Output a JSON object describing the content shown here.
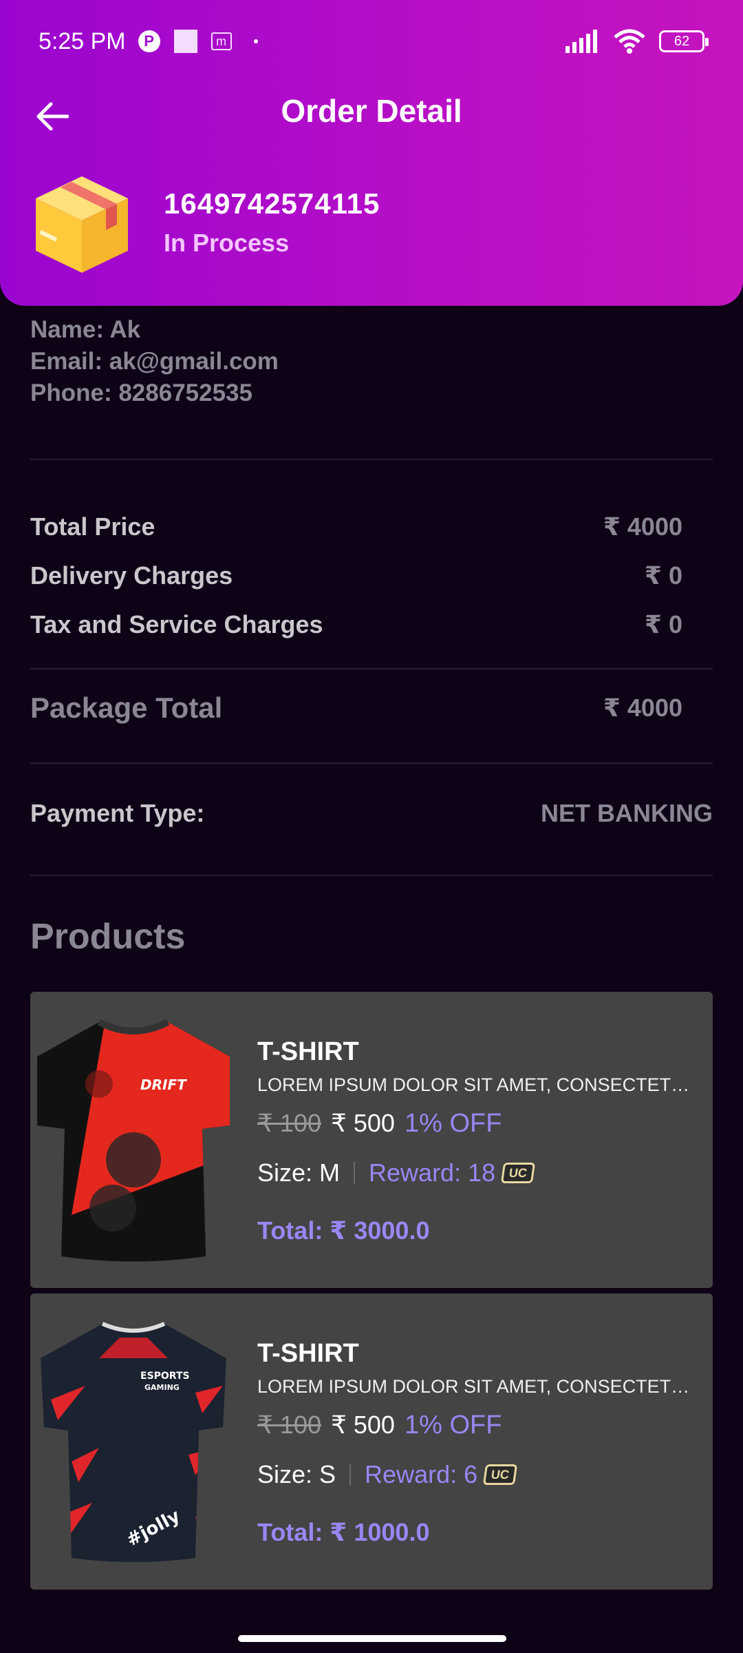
{
  "status_bar": {
    "time": "5:25 PM",
    "battery": "62"
  },
  "header": {
    "title": "Order Detail",
    "order_id": "1649742574115",
    "order_status": "In Process"
  },
  "customer": {
    "name": "Name: Ak",
    "email": "Email: ak@gmail.com",
    "phone": "Phone: 8286752535"
  },
  "charges": {
    "total_price_label": "Total Price",
    "total_price_value": "₹ 4000",
    "delivery_label": "Delivery Charges",
    "delivery_value": "₹ 0",
    "tax_label": "Tax and Service Charges",
    "tax_value": "₹ 0",
    "package_total_label": "Package Total",
    "package_total_value": "₹ 4000"
  },
  "payment": {
    "label": "Payment Type:",
    "value": "NET BANKING"
  },
  "products_title": "Products",
  "products": [
    {
      "name": "T-SHIRT",
      "description": "LOREM IPSUM DOLOR SIT AMET, CONSECTETUR ADIPISCING ELIT",
      "old_price": "₹ 100",
      "new_price": "₹ 500",
      "discount": "1% OFF",
      "size": "Size: M",
      "reward": "Reward: 18",
      "badge": "UC",
      "total": "Total: ₹ 3000.0"
    },
    {
      "name": "T-SHIRT",
      "description": "LOREM IPSUM DOLOR SIT AMET, CONSECTETUR ADIPISCING ELIT",
      "old_price": "₹ 100",
      "new_price": "₹ 500",
      "discount": "1% OFF",
      "size": "Size: S",
      "reward": "Reward: 6",
      "badge": "UC",
      "total": "Total: ₹ 1000.0"
    }
  ],
  "shirt_graphics": {
    "shirt1": "DRIFT",
    "shirt2_line1": "ESPORTS",
    "shirt2_line2": "GAMING",
    "shirt2_back": "#jolly"
  },
  "colors": {
    "header_start": "#9a05cf",
    "header_end": "#c514be",
    "accent": "#9b86f5",
    "background": "#0e0216",
    "card": "#444444"
  },
  "icons": {
    "back": "arrow-left-icon",
    "box": "package-box-icon",
    "signal": "signal-icon",
    "wifi": "wifi-icon",
    "battery": "battery-icon"
  }
}
